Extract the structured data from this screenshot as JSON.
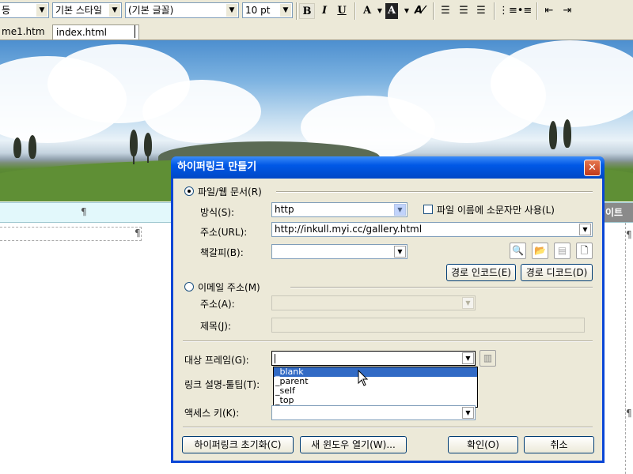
{
  "toolbar": {
    "style_combo": "기본 스타일",
    "font_combo": "(기본 글꼴)",
    "size_combo": "10 pt",
    "left_combo_glyph": "등",
    "bold": "B",
    "italic": "I",
    "underline": "U",
    "font_color": "A",
    "highlight": "A"
  },
  "tabs": [
    {
      "label": "me1.htm"
    },
    {
      "label": "index.html"
    }
  ],
  "page": {
    "pilcrow": "¶",
    "strip_right_text": "이트"
  },
  "dialog": {
    "title": "하이퍼링크 만들기",
    "close_glyph": "✕",
    "radio_file_web": "파일/웹 문서(R)",
    "method_label": "방식(S):",
    "method_value": "http",
    "lowercase_checkbox": "파일 이름에 소문자만 사용(L)",
    "url_label": "주소(URL):",
    "url_value": "http://inkull.myi.cc/gallery.html",
    "bookmark_label": "책갈피(B):",
    "bookmark_value": "",
    "path_encode_button": "경로 인코드(E)",
    "path_decode_button": "경로 디코드(D)",
    "radio_email": "이메일 주소(M)",
    "email_address_label": "주소(A):",
    "email_subject_label": "제목(J):",
    "target_frame_label": "대상 프레임(G):",
    "target_frame_value": "",
    "target_options": [
      "_blank",
      "_parent",
      "_self",
      "_top"
    ],
    "target_highlighted": "_blank",
    "tooltip_label": "링크 설명-툴팁(T):",
    "access_key_label": "액세스 키(K):",
    "reset_button": "하이퍼링크 초기화(C)",
    "new_window_button": "새 윈도우 열기(W)...",
    "ok_button": "확인(O)",
    "cancel_button": "취소"
  }
}
